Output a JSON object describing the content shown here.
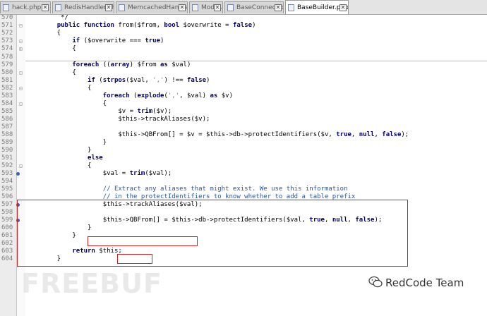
{
  "tabs": [
    {
      "label": "hack.php",
      "active": false
    },
    {
      "label": "RedisHandler.php",
      "active": false
    },
    {
      "label": "MemcachedHandler.php",
      "active": false
    },
    {
      "label": "Model.php",
      "active": false
    },
    {
      "label": "BaseConnection.php",
      "active": false
    },
    {
      "label": "BaseBuilder.php",
      "active": true
    }
  ],
  "close_glyph": "✕",
  "lines": [
    {
      "n": "570",
      "html": "     */"
    },
    {
      "n": "571",
      "html": "    <span class='k'>public function</span> from($from, <span class='k'>bool</span> $overwrite = <span class='k'>false</span>)"
    },
    {
      "n": "572",
      "html": "    {"
    },
    {
      "n": "573",
      "html": "        <span class='k'>if</span> ($overwrite === <span class='k'>true</span>)"
    },
    {
      "n": "574",
      "html": "        {"
    },
    {
      "n": "578",
      "html": ""
    },
    {
      "n": "579",
      "html": "        <span class='k'>foreach</span> ((<span class='k'>array</span>) $from <span class='k'>as</span> $val)"
    },
    {
      "n": "580",
      "html": "        {"
    },
    {
      "n": "581",
      "html": "            <span class='k'>if</span> (<span class='k'>strpos</span>($val, <span class='s'>','</span>) !== <span class='k'>false</span>)"
    },
    {
      "n": "582",
      "html": "            {"
    },
    {
      "n": "583",
      "html": "                <span class='k'>foreach</span> (<span class='k'>explode</span>(<span class='s'>','</span>, $val) <span class='k'>as</span> $v)"
    },
    {
      "n": "584",
      "html": "                {"
    },
    {
      "n": "585",
      "html": "                    $v = <span class='k'>trim</span>($v);"
    },
    {
      "n": "586",
      "html": "                    $this->trackAliases($v);"
    },
    {
      "n": "587",
      "html": ""
    },
    {
      "n": "588",
      "html": "                    $this->QBFrom[] = $v = $this->db->protectIdentifiers($v, <span class='k'>true</span>, <span class='k'>null</span>, <span class='k'>false</span>);"
    },
    {
      "n": "589",
      "html": "                }"
    },
    {
      "n": "590",
      "html": "            }"
    },
    {
      "n": "591",
      "html": "            <span class='k'>else</span>"
    },
    {
      "n": "592",
      "html": "            {"
    },
    {
      "n": "593",
      "html": "                $val = <span class='k'>trim</span>($val);"
    },
    {
      "n": "594",
      "html": ""
    },
    {
      "n": "595",
      "html": "                <span class='cm'>// Extract any aliases that might exist. We use this information</span>"
    },
    {
      "n": "596",
      "html": "                <span class='cm'>// in the protectIdentifiers to know whether to add a table prefix</span>"
    },
    {
      "n": "597",
      "html": "                $this->trackAliases($val);"
    },
    {
      "n": "598",
      "html": ""
    },
    {
      "n": "599",
      "html": "                $this->QBFrom[] = $this->db->protectIdentifiers($val, <span class='k'>true</span>, <span class='k'>null</span>, <span class='k'>false</span>);"
    },
    {
      "n": "600",
      "html": "            }"
    },
    {
      "n": "601",
      "html": "        }"
    },
    {
      "n": "602",
      "html": ""
    },
    {
      "n": "603",
      "html": "        <span class='k'>return</span> $this;"
    },
    {
      "n": "604",
      "html": "    }"
    }
  ],
  "watermark_left": "FREEBUF",
  "watermark_right": "RedCode Team"
}
